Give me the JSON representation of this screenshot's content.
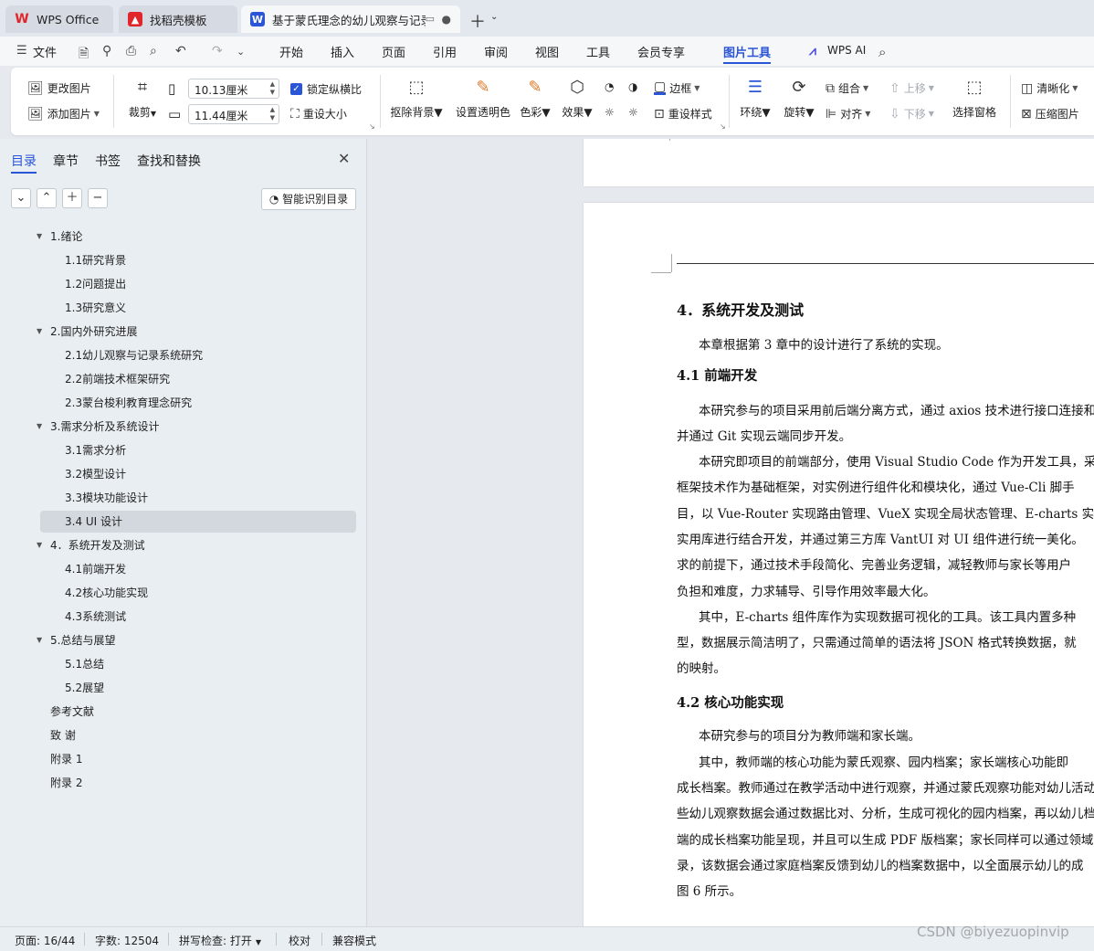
{
  "tabs": [
    {
      "label": "WPS Office"
    },
    {
      "label": "找稻壳模板"
    },
    {
      "label": "基于蒙氏理念的幼儿观察与记录"
    }
  ],
  "menu": [
    "文件",
    "开始",
    "插入",
    "页面",
    "引用",
    "审阅",
    "视图",
    "工具",
    "会员专享",
    "图片工具",
    "WPS AI"
  ],
  "ribbon": {
    "change_image": "更改图片",
    "add_image": "添加图片",
    "crop": "裁剪",
    "width": "10.13厘米",
    "height": "11.44厘米",
    "lock_ratio": "锁定纵横比",
    "reset_size": "重设大小",
    "remove_bg": "抠除背景",
    "set_transparent": "设置透明色",
    "color": "色彩",
    "effects": "效果",
    "border": "边框",
    "reset_style": "重设样式",
    "wrap": "环绕",
    "rotate": "旋转",
    "group": "组合",
    "align": "对齐",
    "move_up": "上移",
    "move_down": "下移",
    "selection_pane": "选择窗格",
    "sharpen": "清晰化",
    "compress": "压缩图片"
  },
  "nav": {
    "tabs": [
      "目录",
      "章节",
      "书签",
      "查找和替换"
    ],
    "smart_toc": "智能识别目录",
    "toc": [
      {
        "label": "1.绪论",
        "level": 1,
        "expandable": true
      },
      {
        "label": "1.1研究背景",
        "level": 2
      },
      {
        "label": "1.2问题提出",
        "level": 2
      },
      {
        "label": "1.3研究意义",
        "level": 2
      },
      {
        "label": "2.国内外研究进展",
        "level": 1,
        "expandable": true
      },
      {
        "label": "2.1幼儿观察与记录系统研究",
        "level": 2
      },
      {
        "label": "2.2前端技术框架研究",
        "level": 2
      },
      {
        "label": "2.3蒙台梭利教育理念研究",
        "level": 2
      },
      {
        "label": "3.需求分析及系统设计",
        "level": 1,
        "expandable": true
      },
      {
        "label": "3.1需求分析",
        "level": 2
      },
      {
        "label": "3.2模型设计",
        "level": 2
      },
      {
        "label": "3.3模块功能设计",
        "level": 2
      },
      {
        "label": "3.4 UI 设计",
        "level": 2,
        "selected": true
      },
      {
        "label": "4．系统开发及测试",
        "level": 1,
        "expandable": true
      },
      {
        "label": "4.1前端开发",
        "level": 2
      },
      {
        "label": "4.2核心功能实现",
        "level": 2
      },
      {
        "label": "4.3系统测试",
        "level": 2
      },
      {
        "label": "5.总结与展望",
        "level": 1,
        "expandable": true
      },
      {
        "label": "5.1总结",
        "level": 2
      },
      {
        "label": "5.2展望",
        "level": 2
      },
      {
        "label": "参考文献",
        "level": 1
      },
      {
        "label": "致  谢",
        "level": 1
      },
      {
        "label": "附录 1",
        "level": 1
      },
      {
        "label": "附录 2",
        "level": 1
      }
    ]
  },
  "document": {
    "lines": [
      {
        "text": "4．系统开发及测试",
        "style": "h1"
      },
      {
        "text": "本章根据第 3 章中的设计进行了系统的实现。",
        "style": "ind"
      },
      {
        "text": "4.1 前端开发",
        "style": "h2"
      },
      {
        "text": "本研究参与的项目采用前后端分离方式，通过 axios 技术进行接口连接和",
        "style": "ind"
      },
      {
        "text": "并通过 Git 实现云端同步开发。",
        "style": ""
      },
      {
        "text": "本研究即项目的前端部分，使用 Visual Studio Code 作为开发工具，采",
        "style": "ind"
      },
      {
        "text": "框架技术作为基础框架，对实例进行组件化和模块化，通过 Vue-Cli 脚手",
        "style": ""
      },
      {
        "text": "目，以 Vue-Router 实现路由管理、VueX 实现全局状态管理、E-charts 实现",
        "style": ""
      },
      {
        "text": "实用库进行结合开发，并通过第三方库 VantUI 对 UI 组件进行统一美化。",
        "style": ""
      },
      {
        "text": "求的前提下，通过技术手段简化、完善业务逻辑，减轻教师与家长等用户",
        "style": ""
      },
      {
        "text": "负担和难度，力求辅导、引导作用效率最大化。",
        "style": ""
      },
      {
        "text": "其中，E-charts 组件库作为实现数据可视化的工具。该工具内置多种",
        "style": "ind"
      },
      {
        "text": "型，数据展示简洁明了，只需通过简单的语法将 JSON 格式转换数据，就",
        "style": ""
      },
      {
        "text": "的映射。",
        "style": ""
      },
      {
        "text": "4.2  核心功能实现",
        "style": "h2"
      },
      {
        "text": "本研究参与的项目分为教师端和家长端。",
        "style": "ind"
      },
      {
        "text": "其中，教师端的核心功能为蒙氏观察、园内档案；家长端核心功能即",
        "style": "ind"
      },
      {
        "text": "成长档案。教师通过在教学活动中进行观察，并通过蒙氏观察功能对幼儿活动",
        "style": ""
      },
      {
        "text": "些幼儿观察数据会通过数据比对、分析，生成可视化的园内档案，再以幼儿档",
        "style": ""
      },
      {
        "text": "端的成长档案功能呈现，并且可以生成 PDF 版档案；家长同样可以通过领域观",
        "style": ""
      },
      {
        "text": "录，该数据会通过家庭档案反馈到幼儿的档案数据中，以全面展示幼儿的成",
        "style": ""
      },
      {
        "text": "图 6 所示。",
        "style": ""
      }
    ]
  },
  "status": {
    "page": "页面: 16/44",
    "words": "字数: 12504",
    "spell": "拼写检查: 打开",
    "proof": "校对",
    "compat": "兼容模式"
  },
  "watermark": "CSDN @biyezuopinvip",
  "colors": {
    "accent": "#2a55d6",
    "wps_red": "#e0262b"
  }
}
